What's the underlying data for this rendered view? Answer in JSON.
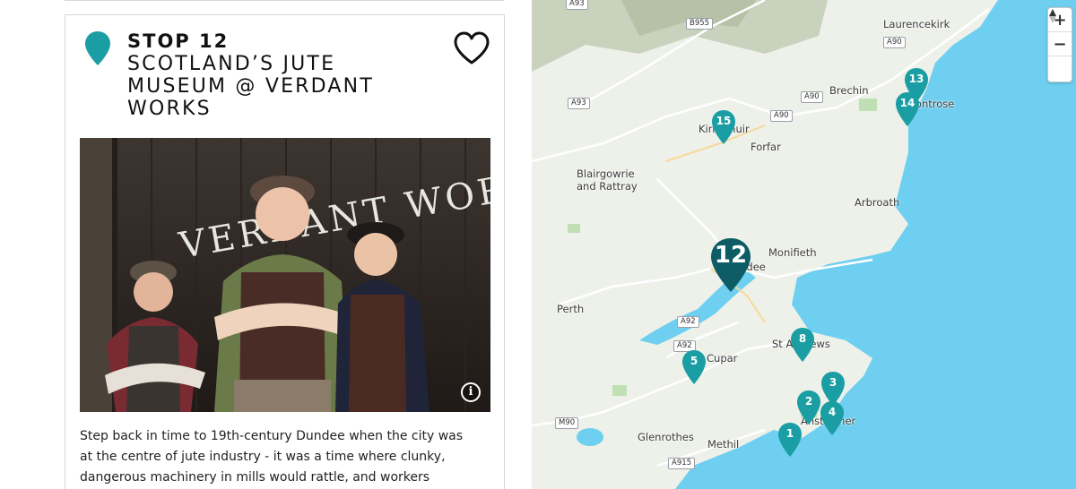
{
  "stop": {
    "number_label": "STOP 12",
    "title": "SCOTLAND’S JUTE MUSEUM @ VERDANT WORKS",
    "description": "Step back in time to 19th-century Dundee when the city was at the centre of jute industry - it was a time where clunky, dangerous machinery in mills would rattle, and workers worked long hours in",
    "photo_sign_text": "VERDANT WORKS",
    "accent_color": "#1a9ea4"
  },
  "icons": {
    "pin": "map-pin-icon",
    "heart": "heart-icon",
    "info": "info-icon",
    "compass": "compass-icon"
  },
  "photo": {
    "info_glyph": "i"
  },
  "map": {
    "places": [
      {
        "name": "Laurencekirk"
      },
      {
        "name": "Brechin"
      },
      {
        "name": "Montrose"
      },
      {
        "name": "Kirriemuir"
      },
      {
        "name": "Forfar"
      },
      {
        "name": "Blairgowrie\nand Rattray"
      },
      {
        "name": "Arbroath"
      },
      {
        "name": "Monifieth"
      },
      {
        "name": "Dundee"
      },
      {
        "name": "Perth"
      },
      {
        "name": "St Andrews"
      },
      {
        "name": "Cupar"
      },
      {
        "name": "Anstruther"
      },
      {
        "name": "Glenrothes"
      },
      {
        "name": "Methil"
      }
    ],
    "roads": [
      "A93",
      "B955",
      "A90",
      "A90",
      "A93",
      "A90",
      "A92",
      "A92",
      "M90",
      "A915"
    ],
    "markers": [
      {
        "label": "12",
        "featured": true
      },
      {
        "label": "13"
      },
      {
        "label": "14"
      },
      {
        "label": "15"
      },
      {
        "label": "8"
      },
      {
        "label": "5"
      },
      {
        "label": "3"
      },
      {
        "label": "2"
      },
      {
        "label": "4"
      },
      {
        "label": "1"
      }
    ],
    "controls": {
      "zoom_in": "+",
      "zoom_out": "−"
    },
    "colors": {
      "water": "#6ecff0",
      "land": "#eef1ea",
      "marker": "#1a9ea4",
      "marker_featured": "#0d5c66"
    }
  }
}
